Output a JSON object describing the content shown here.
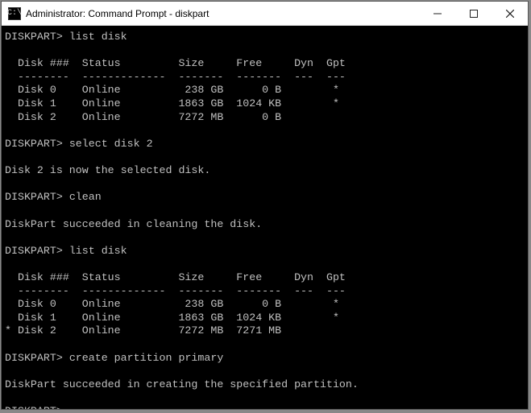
{
  "window": {
    "title": "Administrator: Command Prompt - diskpart",
    "icon_label": "cmd-icon"
  },
  "terminal": {
    "prompt": "DISKPART>",
    "commands": {
      "list_disk": "list disk",
      "select_disk_2": "select disk 2",
      "clean": "clean",
      "create_partition": "create partition primary"
    },
    "messages": {
      "selected": "Disk 2 is now the selected disk.",
      "clean_ok": "DiskPart succeeded in cleaning the disk.",
      "partition_ok": "DiskPart succeeded in creating the specified partition."
    },
    "table1": {
      "header": "  Disk ###  Status         Size     Free     Dyn  Gpt",
      "divider": "  --------  -------------  -------  -------  ---  ---",
      "rows": [
        "  Disk 0    Online          238 GB      0 B        *",
        "  Disk 1    Online         1863 GB  1024 KB        *",
        "  Disk 2    Online         7272 MB      0 B"
      ]
    },
    "table2": {
      "header": "  Disk ###  Status         Size     Free     Dyn  Gpt",
      "divider": "  --------  -------------  -------  -------  ---  ---",
      "rows": [
        "  Disk 0    Online          238 GB      0 B        *",
        "  Disk 1    Online         1863 GB  1024 KB        *",
        "* Disk 2    Online         7272 MB  7271 MB"
      ]
    }
  }
}
